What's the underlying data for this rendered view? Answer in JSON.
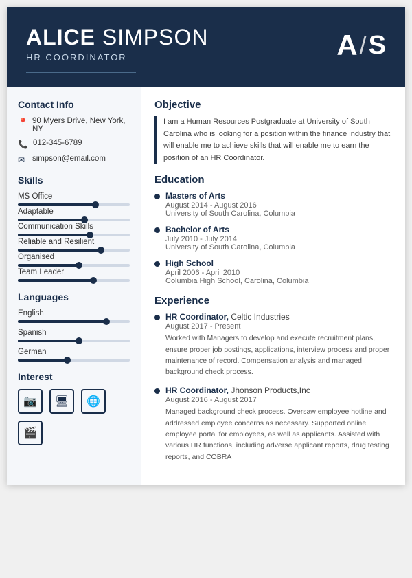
{
  "header": {
    "first_name": "ALICE",
    "last_name": "SIMPSON",
    "title": "HR COORDINATOR",
    "monogram_a": "A",
    "monogram_slash": "/",
    "monogram_s": "S"
  },
  "contact": {
    "section_title": "Contact Info",
    "address": "90 Myers Drive, New York, NY",
    "phone": "012-345-6789",
    "email": "simpson@email.com"
  },
  "skills": {
    "section_title": "Skills",
    "items": [
      {
        "name": "MS Office",
        "percent": 70
      },
      {
        "name": "Adaptable",
        "percent": 60
      },
      {
        "name": "Communication Skills",
        "percent": 65
      },
      {
        "name": "Reliable and Resilient",
        "percent": 75
      },
      {
        "name": "Organised",
        "percent": 55
      },
      {
        "name": "Team Leader",
        "percent": 68
      }
    ]
  },
  "languages": {
    "section_title": "Languages",
    "items": [
      {
        "name": "English",
        "percent": 80
      },
      {
        "name": "Spanish",
        "percent": 55
      },
      {
        "name": "German",
        "percent": 45
      }
    ]
  },
  "interest": {
    "section_title": "Interest",
    "icons": [
      "📷",
      "🖥",
      "🌐",
      "🎬"
    ]
  },
  "objective": {
    "section_title": "Objective",
    "text": "I am a Human Resources Postgraduate at University of South Carolina who is looking for a position within the finance industry that will enable me to achieve skills that will enable me to earn the position of an HR Coordinator."
  },
  "education": {
    "section_title": "Education",
    "items": [
      {
        "degree": "Masters of Arts",
        "date": "August 2014 - August 2016",
        "school": "University of South Carolina, Columbia"
      },
      {
        "degree": "Bachelor of Arts",
        "date": "July 2010 - July 2014",
        "school": "University of South Carolina, Columbia"
      },
      {
        "degree": "High School",
        "date": "April 2006 - April 2010",
        "school": "Columbia High School, Carolina, Columbia"
      }
    ]
  },
  "experience": {
    "section_title": "Experience",
    "items": [
      {
        "title": "HR Coordinator",
        "company": "Celtic Industries",
        "date": "August 2017 - Present",
        "desc": "Worked with Managers to develop and execute recruitment plans, ensure proper job postings, applications, interview process and proper maintenance of record. Compensation analysis and managed background check process."
      },
      {
        "title": "HR Coordinator",
        "company": "Jhonson Products,Inc",
        "date": "August 2016 - August 2017",
        "desc": "Managed background check process. Oversaw employee hotline and addressed employee concerns as necessary. Supported online employee portal for employees, as well as applicants. Assisted with various HR functions, including adverse applicant reports, drug testing reports, and COBRA"
      }
    ]
  }
}
